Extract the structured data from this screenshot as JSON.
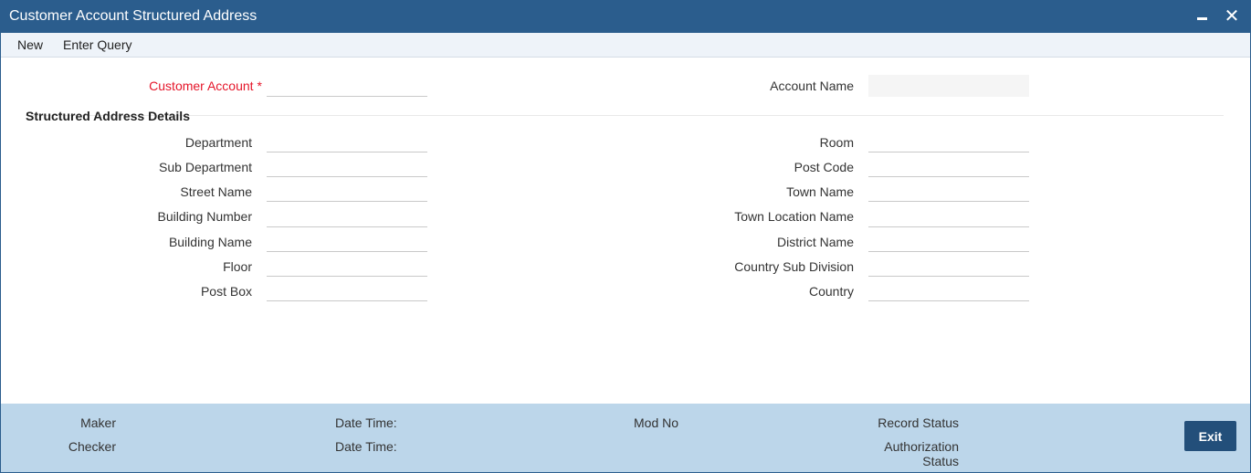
{
  "window": {
    "title": "Customer Account Structured Address"
  },
  "toolbar": {
    "new_label": "New",
    "enter_query_label": "Enter Query"
  },
  "header_fields": {
    "customer_account": {
      "label": "Customer Account",
      "required_mark": "*",
      "value": ""
    },
    "account_name": {
      "label": "Account Name",
      "value": ""
    }
  },
  "section": {
    "title": "Structured Address Details"
  },
  "left_fields": [
    {
      "label": "Department",
      "value": ""
    },
    {
      "label": "Sub Department",
      "value": ""
    },
    {
      "label": "Street Name",
      "value": ""
    },
    {
      "label": "Building Number",
      "value": ""
    },
    {
      "label": "Building Name",
      "value": ""
    },
    {
      "label": "Floor",
      "value": ""
    },
    {
      "label": "Post Box",
      "value": ""
    }
  ],
  "right_fields": [
    {
      "label": "Room",
      "value": ""
    },
    {
      "label": "Post Code",
      "value": ""
    },
    {
      "label": "Town Name",
      "value": ""
    },
    {
      "label": "Town Location Name",
      "value": ""
    },
    {
      "label": "District Name",
      "value": ""
    },
    {
      "label": "Country Sub Division",
      "value": ""
    },
    {
      "label": "Country",
      "value": ""
    }
  ],
  "footer": {
    "maker_label": "Maker",
    "checker_label": "Checker",
    "date_time_label_1": "Date Time:",
    "date_time_label_2": "Date Time:",
    "mod_no_label": "Mod No",
    "record_status_label": "Record Status",
    "authorization_status_line1": "Authorization",
    "authorization_status_line2": "Status",
    "exit_label": "Exit"
  },
  "colors": {
    "titlebar": "#2b5d8d",
    "footer": "#bcd6ea",
    "required": "#e5162a",
    "exit_button": "#234f7a"
  }
}
